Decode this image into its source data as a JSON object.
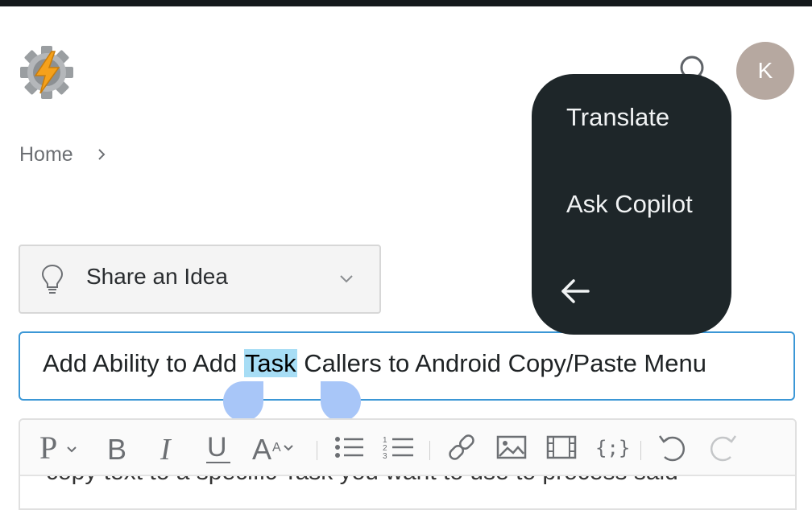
{
  "header": {
    "logo_icon": "tasker-gear-bolt-icon",
    "search_icon": "search-icon",
    "avatar_initial": "K"
  },
  "breadcrumb": {
    "home": "Home"
  },
  "idea_select": {
    "icon": "lightbulb-icon",
    "selected": "Share an Idea"
  },
  "title_field": {
    "text_before": "Add Ability to Add ",
    "selected_text": "Task",
    "text_after": " Callers to Android Copy/Paste Menu"
  },
  "editor": {
    "toolbar_icons": [
      "paragraph-format-icon",
      "bold-icon",
      "italic-icon",
      "underline-icon",
      "font-size-icon",
      "bullet-list-icon",
      "numbered-list-icon",
      "link-icon",
      "image-icon",
      "video-icon",
      "code-icon",
      "undo-icon",
      "redo-icon"
    ],
    "body_text": "copy text to a specific Task you want to use to process said"
  },
  "context_menu": {
    "items": [
      "Translate",
      "Ask Copilot"
    ],
    "back_icon": "arrow-left-icon"
  },
  "colors": {
    "accent_border": "#3b97d6",
    "selection_highlight": "#a7ddf5",
    "selection_handle": "#a8c6f8",
    "menu_background": "#1e2629",
    "avatar_background": "#b6a8a0"
  }
}
